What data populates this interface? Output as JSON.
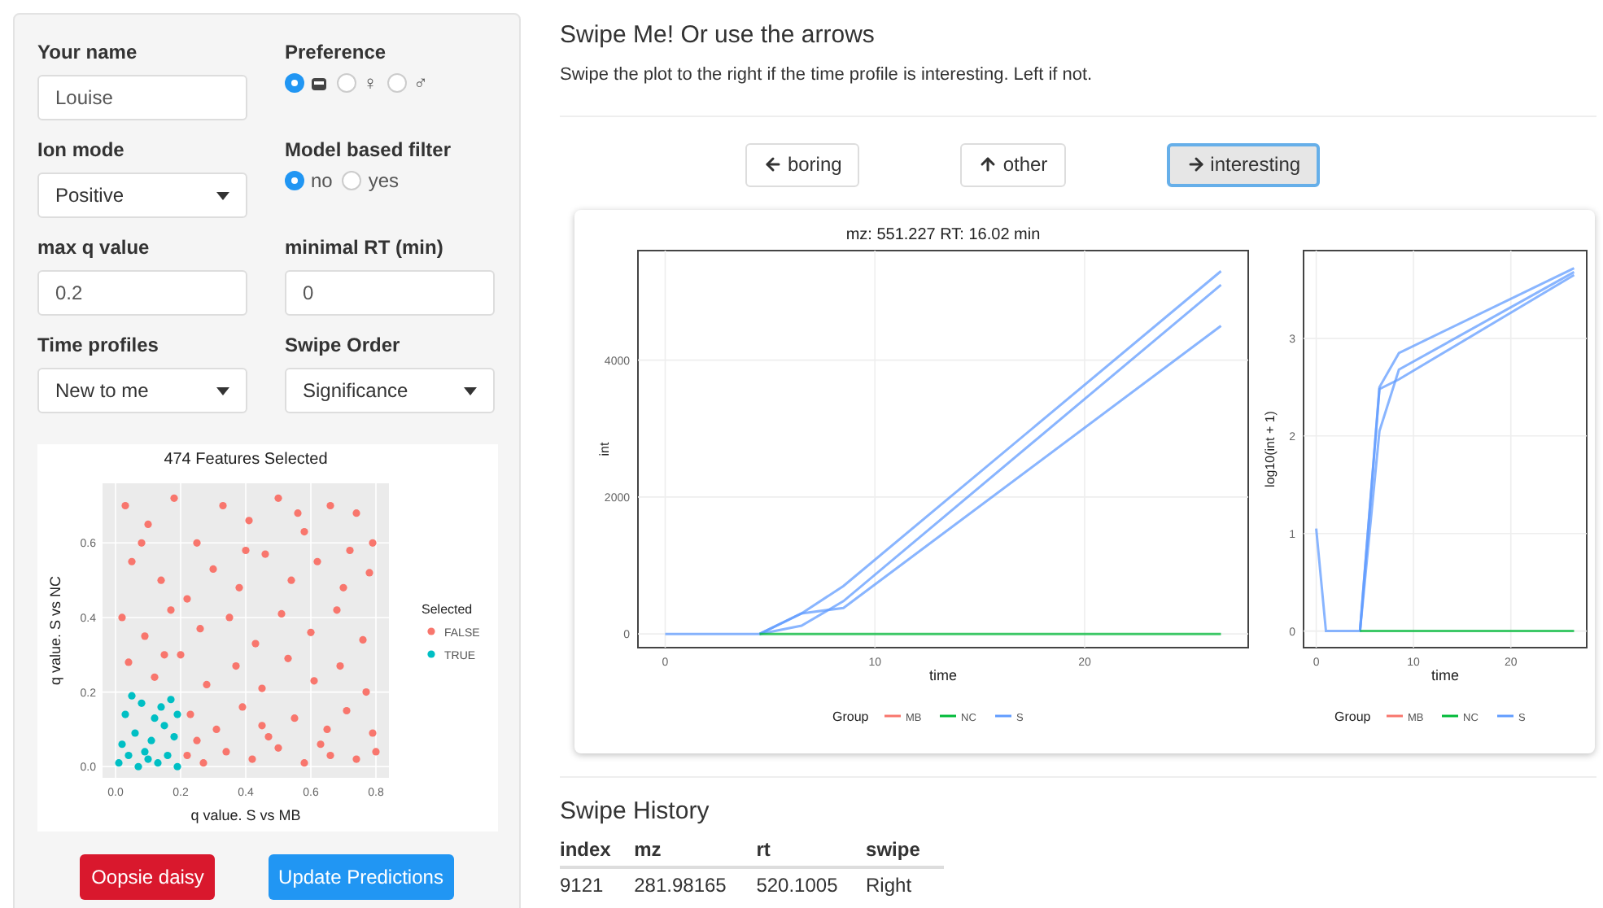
{
  "sidebar": {
    "fields": [
      {
        "kind": "text",
        "label": "Your name",
        "value": "Louise"
      },
      {
        "kind": "radio",
        "label": "Preference",
        "options": [
          {
            "kind": "icon",
            "selected": true
          },
          {
            "kind": "text",
            "label": "♀",
            "selected": false
          },
          {
            "kind": "text",
            "label": "♂",
            "selected": false
          }
        ]
      },
      {
        "kind": "select",
        "label": "Ion mode",
        "value": "Positive"
      },
      {
        "kind": "radio",
        "label": "Model based filter",
        "options": [
          {
            "kind": "text",
            "label": "no",
            "selected": true
          },
          {
            "kind": "text",
            "label": "yes",
            "selected": false
          }
        ]
      },
      {
        "kind": "text",
        "label": "max q value",
        "value": "0.2"
      },
      {
        "kind": "text",
        "label": "minimal RT (min)",
        "value": "0"
      },
      {
        "kind": "select",
        "label": "Time profiles",
        "value": "New to me"
      },
      {
        "kind": "select",
        "label": "Swipe Order",
        "value": "Significance"
      }
    ],
    "scatter": {
      "chart_data": {
        "type": "scatter",
        "legend": {
          "title": "Selected"
        },
        "title": "474 Features Selected",
        "xlabel": "q value. S vs MB",
        "ylabel": "q value. S vs NC",
        "grid": true,
        "xlim": [
          -0.04,
          0.84
        ],
        "ylim": [
          -0.03,
          0.76
        ],
        "xticks": [
          {
            "value": 0,
            "label": "0.0"
          },
          {
            "value": 0.2,
            "label": "0.2"
          },
          {
            "value": 0.4,
            "label": "0.4"
          },
          {
            "value": 0.6,
            "label": "0.6"
          },
          {
            "value": 0.8,
            "label": "0.8"
          }
        ],
        "yticks": [
          {
            "value": 0,
            "label": "0.0"
          },
          {
            "value": 0.2,
            "label": "0.2"
          },
          {
            "value": 0.4,
            "label": "0.4"
          },
          {
            "value": 0.6,
            "label": "0.6"
          }
        ],
        "series": [
          {
            "name": "FALSE",
            "color": "#f8766d",
            "x": [
              0.03,
              0.1,
              0.18,
              0.25,
              0.33,
              0.41,
              0.5,
              0.58,
              0.66,
              0.74,
              0.79,
              0.05,
              0.14,
              0.22,
              0.3,
              0.38,
              0.46,
              0.54,
              0.62,
              0.7,
              0.78,
              0.02,
              0.09,
              0.17,
              0.26,
              0.35,
              0.43,
              0.51,
              0.6,
              0.68,
              0.76,
              0.04,
              0.12,
              0.2,
              0.28,
              0.37,
              0.45,
              0.53,
              0.61,
              0.69,
              0.77,
              0.23,
              0.31,
              0.39,
              0.47,
              0.55,
              0.63,
              0.71,
              0.79,
              0.22,
              0.27,
              0.34,
              0.42,
              0.5,
              0.58,
              0.66,
              0.74,
              0.8,
              0.25,
              0.45,
              0.65,
              0.08,
              0.56,
              0.72,
              0.15,
              0.4
            ],
            "values": [
              0.7,
              0.65,
              0.72,
              0.6,
              0.7,
              0.66,
              0.72,
              0.63,
              0.7,
              0.68,
              0.6,
              0.55,
              0.5,
              0.45,
              0.53,
              0.48,
              0.57,
              0.5,
              0.55,
              0.48,
              0.52,
              0.4,
              0.35,
              0.42,
              0.37,
              0.4,
              0.33,
              0.41,
              0.36,
              0.42,
              0.34,
              0.28,
              0.24,
              0.3,
              0.22,
              0.27,
              0.21,
              0.29,
              0.23,
              0.27,
              0.2,
              0.14,
              0.1,
              0.16,
              0.08,
              0.13,
              0.06,
              0.15,
              0.09,
              0.03,
              0.01,
              0.04,
              0.02,
              0.05,
              0.01,
              0.03,
              0.02,
              0.04,
              0.07,
              0.11,
              0.1,
              0.6,
              0.68,
              0.58,
              0.3,
              0.58
            ]
          },
          {
            "name": "TRUE",
            "color": "#00bfc4",
            "x": [
              0.01,
              0.04,
              0.07,
              0.1,
              0.13,
              0.16,
              0.19,
              0.02,
              0.06,
              0.11,
              0.15,
              0.18,
              0.03,
              0.08,
              0.12,
              0.17,
              0.05,
              0.14,
              0.09,
              0.19
            ],
            "values": [
              0.01,
              0.03,
              0.0,
              0.02,
              0.01,
              0.03,
              0.0,
              0.06,
              0.09,
              0.07,
              0.11,
              0.08,
              0.14,
              0.17,
              0.13,
              0.18,
              0.19,
              0.16,
              0.04,
              0.14
            ]
          }
        ]
      }
    },
    "buttons": [
      {
        "label": "Oopsie daisy",
        "kind": "danger"
      },
      {
        "label": "Update Predictions",
        "kind": "primary"
      }
    ]
  },
  "main": {
    "title": "Swipe Me! Or use the arrows",
    "subtitle": "Swipe the plot to the right if the time profile is interesting. Left if not.",
    "swipe_buttons": [
      {
        "label": "boring",
        "kind": "left",
        "selected": false
      },
      {
        "label": "other",
        "kind": "up",
        "selected": false
      },
      {
        "label": "interesting",
        "kind": "right",
        "selected": true
      }
    ],
    "plots": [
      {
        "chart_data": {
          "type": "line",
          "legend": {
            "title": "Group"
          },
          "title": "mz: 551.227   RT: 16.02 min",
          "xlabel": "time",
          "ylabel": "int",
          "grid": true,
          "x": [
            0,
            1,
            2,
            4.5,
            6.5,
            8.5,
            26.5
          ],
          "xlim": [
            -1.3,
            27.8
          ],
          "ylim": [
            -200,
            5600
          ],
          "xticks": [
            {
              "value": 0,
              "label": "0"
            },
            {
              "value": 10,
              "label": "10"
            },
            {
              "value": 20,
              "label": "20"
            }
          ],
          "yticks": [
            {
              "value": 0,
              "label": "0"
            },
            {
              "value": 2000,
              "label": "2000"
            },
            {
              "value": 4000,
              "label": "4000"
            }
          ],
          "series": [
            {
              "name": "MB",
              "color": "#f8766d",
              "values": [
                null,
                null,
                null,
                null,
                null,
                null,
                null
              ]
            },
            {
              "name": "NC",
              "color": "#00ba38",
              "values": [
                null,
                null,
                null,
                0,
                0,
                0,
                0
              ]
            },
            {
              "name": "S",
              "color": "#619cff",
              "values": [
                0,
                0,
                0,
                0,
                300,
                700,
                5300
              ]
            },
            {
              "color": "#619cff",
              "values": [
                null,
                null,
                null,
                0,
                120,
                480,
                5100
              ]
            },
            {
              "color": "#619cff",
              "values": [
                null,
                null,
                null,
                0,
                300,
                380,
                4500
              ]
            }
          ]
        }
      },
      {
        "chart_data": {
          "type": "line",
          "legend": {
            "title": "Group"
          },
          "xlabel": "time",
          "ylabel": "log10(int + 1)",
          "grid": true,
          "x": [
            0,
            1,
            2,
            4.5,
            6.5,
            8.5,
            26.5
          ],
          "xlim": [
            -1.3,
            27.8
          ],
          "ylim": [
            -0.17,
            3.9
          ],
          "xticks": [
            {
              "value": 0,
              "label": "0"
            },
            {
              "value": 10,
              "label": "10"
            },
            {
              "value": 20,
              "label": "20"
            }
          ],
          "yticks": [
            {
              "value": 0,
              "label": "0"
            },
            {
              "value": 1,
              "label": "1"
            },
            {
              "value": 2,
              "label": "2"
            },
            {
              "value": 3,
              "label": "3"
            }
          ],
          "series": [
            {
              "name": "MB",
              "color": "#f8766d",
              "values": [
                null,
                null,
                null,
                null,
                null,
                null,
                null
              ]
            },
            {
              "name": "NC",
              "color": "#00ba38",
              "values": [
                null,
                null,
                null,
                0,
                0,
                0,
                0
              ]
            },
            {
              "name": "S",
              "color": "#619cff",
              "values": [
                1.05,
                0,
                0,
                0,
                2.5,
                2.85,
                3.72
              ]
            },
            {
              "color": "#619cff",
              "values": [
                null,
                null,
                null,
                0,
                2.05,
                2.68,
                3.68
              ]
            },
            {
              "color": "#619cff",
              "values": [
                null,
                null,
                null,
                0,
                2.48,
                2.58,
                3.65
              ]
            }
          ]
        }
      }
    ],
    "history": {
      "title": "Swipe History",
      "columns": [
        "index",
        "mz",
        "rt",
        "swipe"
      ],
      "rows": [
        [
          "9121",
          "281.98165",
          "520.1005",
          "Right"
        ]
      ]
    }
  }
}
